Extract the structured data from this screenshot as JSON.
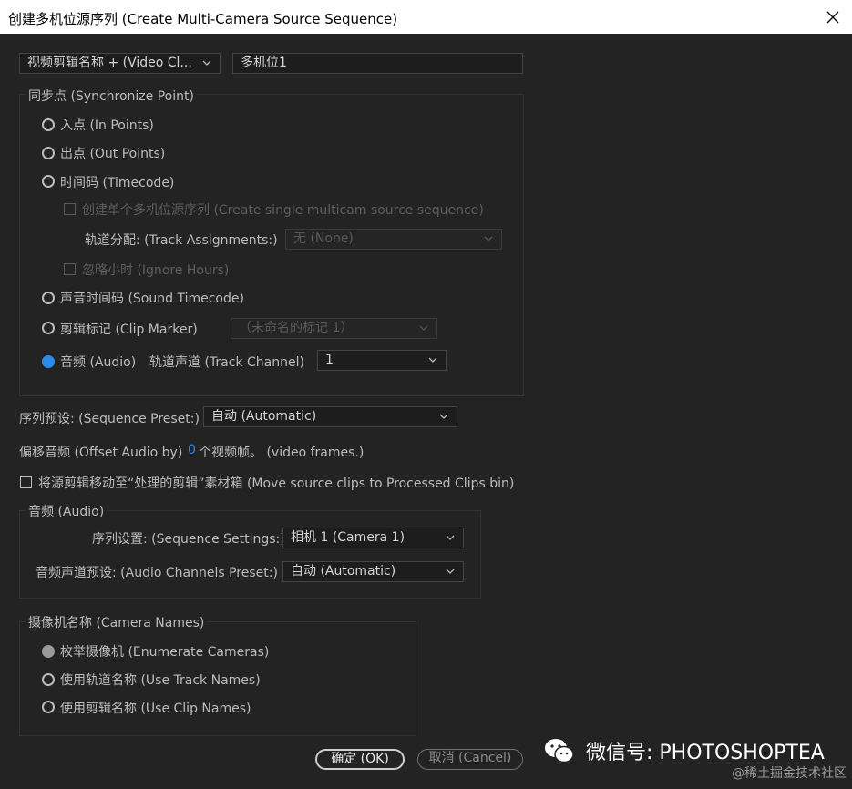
{
  "window": {
    "title": "创建多机位源序列 (Create Multi-Camera Source Sequence)"
  },
  "name_row": {
    "dropdown_value": "视频剪辑名称 + (Video Cl...",
    "name_value": "多机位1"
  },
  "sync": {
    "group_label": "同步点 (Synchronize Point)",
    "in_points": "入点 (In Points)",
    "out_points": "出点 (Out Points)",
    "timecode": "时间码 (Timecode)",
    "create_single": "创建单个多机位源序列 (Create single multicam source sequence)",
    "track_assignments_label": "轨道分配: (Track Assignments:)",
    "track_assignments_value": "无 (None)",
    "ignore_hours": "忽略小时 (Ignore Hours)",
    "sound_timecode": "声音时间码 (Sound Timecode)",
    "clip_marker": "剪辑标记 (Clip Marker)",
    "clip_marker_value": "（未命名的标记 1）",
    "audio": "音频 (Audio)",
    "track_channel_label": "轨道声道 (Track Channel)",
    "track_channel_value": "1",
    "selected": "audio"
  },
  "sequence_preset": {
    "label": "序列预设: (Sequence Preset:)",
    "value": "自动 (Automatic)"
  },
  "offset_audio": {
    "label": "偏移音频 (Offset Audio by)",
    "value": "0",
    "suffix": "个视频帧。 (video frames.)"
  },
  "move_source": {
    "label": "将源剪辑移动至“处理的剪辑”素材箱 (Move source clips to Processed Clips bin)",
    "checked": false
  },
  "audio_group": {
    "label": "音频 (Audio)",
    "sequence_settings_label": "序列设置: (Sequence Settings:)",
    "sequence_settings_value": "相机 1 (Camera 1)",
    "channels_preset_label": "音频声道预设: (Audio Channels Preset:)",
    "channels_preset_value": "自动 (Automatic)"
  },
  "camera_names": {
    "label": "摄像机名称 (Camera Names)",
    "enumerate": "枚举摄像机 (Enumerate Cameras)",
    "track_names": "使用轨道名称 (Use Track Names)",
    "clip_names": "使用剪辑名称 (Use Clip Names)"
  },
  "buttons": {
    "ok": "确定 (OK)",
    "cancel": "取消 (Cancel)"
  },
  "watermark": {
    "main": "微信号: PHOTOSHOPTEA",
    "sub": "@稀土掘金技术社区"
  },
  "colors": {
    "accent": "#2d8ceb",
    "background": "#232323",
    "titlebar": "#ffffff"
  },
  "icons": {
    "close": "close-icon",
    "chevron": "chevron-down-icon",
    "wechat": "wechat-icon"
  }
}
